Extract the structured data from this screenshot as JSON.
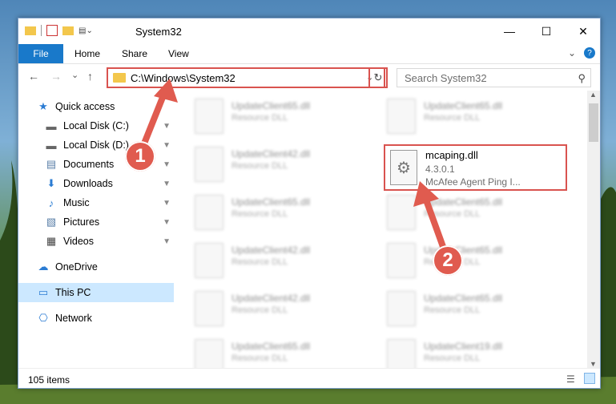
{
  "window": {
    "title": "System32",
    "minimize_glyph": "—",
    "maximize_glyph": "☐",
    "close_glyph": "✕"
  },
  "ribbon": {
    "tabs": [
      "File",
      "Home",
      "Share",
      "View"
    ],
    "expand_glyph": "⌄",
    "help_glyph": "?"
  },
  "address": {
    "path": "C:\\Windows\\System32",
    "refresh_glyph": "↻",
    "dropdown_glyph": "⌄"
  },
  "search": {
    "placeholder": "Search System32",
    "icon_glyph": "⚲"
  },
  "nav_buttons": {
    "back": "←",
    "forward": "→",
    "recent": "⌄",
    "up": "↑"
  },
  "sidebar": {
    "items": [
      {
        "label": "Quick access",
        "icon": "star-icon",
        "glyph": "★",
        "pinned": false
      },
      {
        "label": "Local Disk (C:)",
        "icon": "drive-icon",
        "glyph": "▬",
        "pinned": true
      },
      {
        "label": "Local Disk (D:)",
        "icon": "drive-icon",
        "glyph": "▬",
        "pinned": true
      },
      {
        "label": "Documents",
        "icon": "documents-icon",
        "glyph": "▤",
        "pinned": true
      },
      {
        "label": "Downloads",
        "icon": "download-icon",
        "glyph": "⬇",
        "pinned": true
      },
      {
        "label": "Music",
        "icon": "music-icon",
        "glyph": "♪",
        "pinned": true
      },
      {
        "label": "Pictures",
        "icon": "pictures-icon",
        "glyph": "▧",
        "pinned": true
      },
      {
        "label": "Videos",
        "icon": "videos-icon",
        "glyph": "▦",
        "pinned": true
      },
      {
        "label": "OneDrive",
        "icon": "cloud-icon",
        "glyph": "☁",
        "pinned": false
      },
      {
        "label": "This PC",
        "icon": "computer-icon",
        "glyph": "▭",
        "pinned": false
      },
      {
        "label": "Network",
        "icon": "network-icon",
        "glyph": "⎔",
        "pinned": false
      }
    ],
    "pin_glyph": "📌"
  },
  "files": {
    "background_items": [
      {
        "name": "UpdateClient65.dll",
        "desc": "Resource DLL"
      },
      {
        "name": "UpdateClient65.dll",
        "desc": "Resource DLL"
      },
      {
        "name": "UpdateClient42.dll",
        "desc": "Resource DLL"
      },
      {
        "name": "UpdateClient65.dll",
        "desc": "Resource DLL"
      },
      {
        "name": "UpdateClient65.dll",
        "desc": "Resource DLL"
      },
      {
        "name": "UpdateClient42.dll",
        "desc": "Resource DLL"
      },
      {
        "name": "UpdateClient65.dll",
        "desc": "Resource DLL"
      },
      {
        "name": "UpdateClient42.dll",
        "desc": "Resource DLL"
      },
      {
        "name": "UpdateClient65.dll",
        "desc": "Resource DLL"
      },
      {
        "name": "UpdateClient65.dll",
        "desc": "Resource DLL"
      },
      {
        "name": "UpdateClient19.dll",
        "desc": "Resource DLL"
      }
    ],
    "highlighted": {
      "name": "mcaping.dll",
      "version": "4.3.0.1",
      "description": "McAfee Agent Ping I..."
    }
  },
  "status": {
    "item_count": "105 items"
  },
  "callouts": {
    "step1": "1",
    "step2": "2",
    "color": "#e05b4f"
  }
}
